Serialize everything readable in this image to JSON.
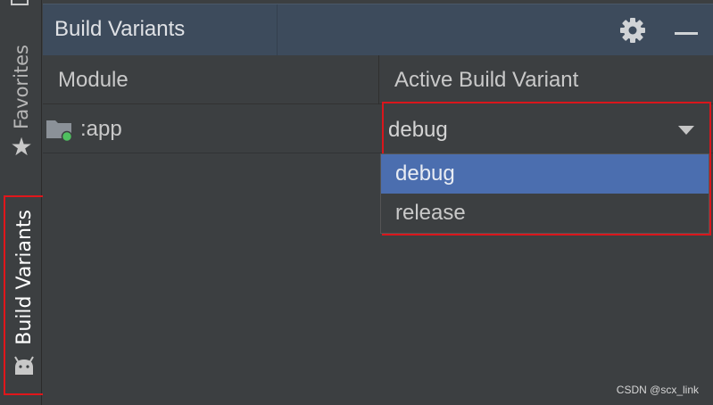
{
  "sidebar": {
    "tabs": [
      {
        "label": "Favorites",
        "icon": "star-icon"
      },
      {
        "label": "Build Variants",
        "icon": "android-icon",
        "highlight_color": "#e0161b"
      }
    ]
  },
  "panel": {
    "title": "Build Variants",
    "actions": [
      {
        "icon": "gear-icon"
      },
      {
        "icon": "minimize-icon"
      }
    ],
    "header_color": "#3d4b5c"
  },
  "table": {
    "columns": [
      "Module",
      "Active Build Variant"
    ],
    "rows": [
      {
        "module": ":app",
        "module_icon": "android-module-folder-icon",
        "active_variant": "debug"
      }
    ]
  },
  "dropdown": {
    "selected": "debug",
    "options": [
      "debug",
      "release"
    ],
    "highlighted_index": 0,
    "highlight_color": "#4b6eaf",
    "outline_color": "#d9161c"
  },
  "watermark": "CSDN @scx_link"
}
